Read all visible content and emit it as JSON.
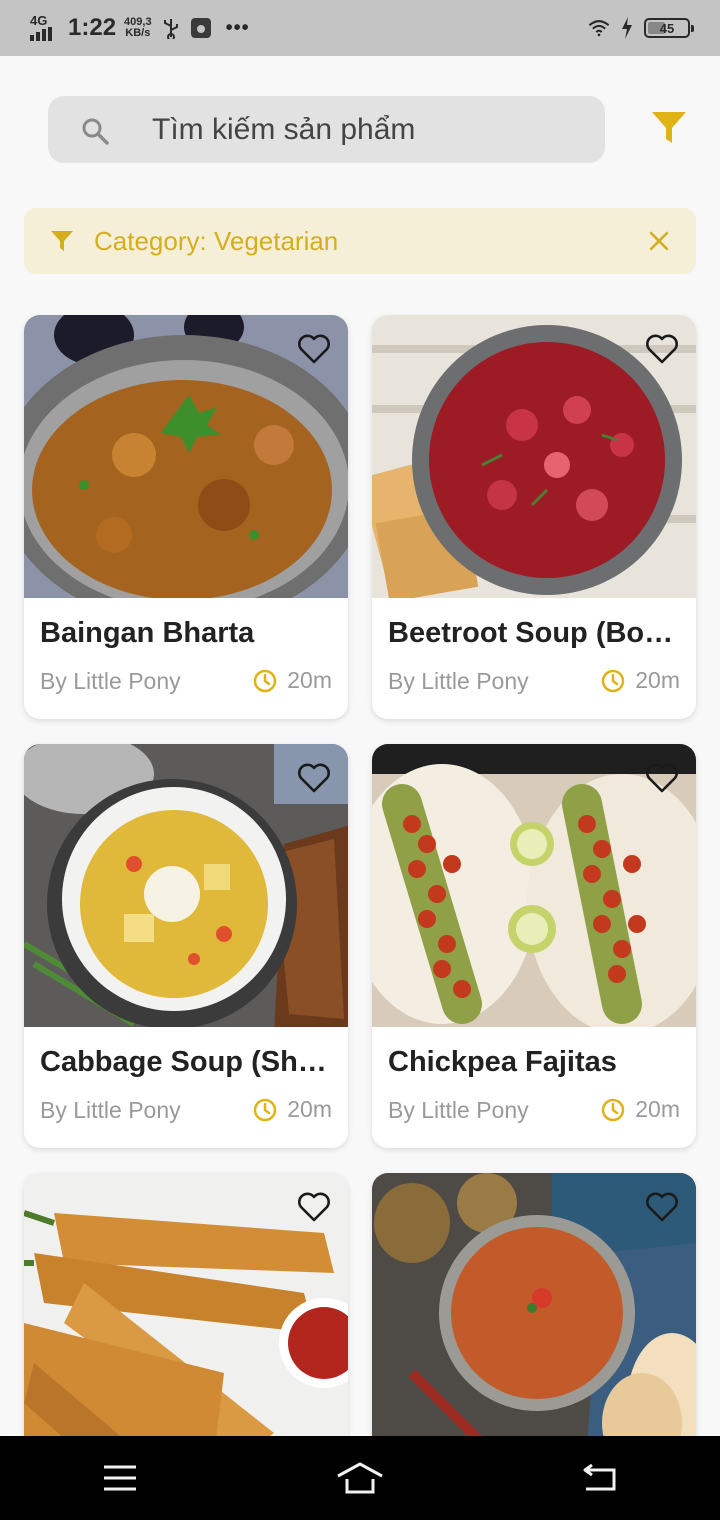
{
  "status_bar": {
    "network": "4G",
    "time": "1:22",
    "speed_value": "409,3",
    "speed_unit": "KB/s",
    "battery": "45",
    "battery_level": 0.45
  },
  "search": {
    "placeholder": "Tìm kiếm sản phẩm"
  },
  "filter_chip": {
    "label": "Category: Vegetarian"
  },
  "colors": {
    "accent": "#e0b315",
    "chip_bg": "#f6efd7",
    "search_bg": "#e2e2e2"
  },
  "recipes": [
    {
      "title": "Baingan Bharta",
      "author": "By Little Pony",
      "time": "20m"
    },
    {
      "title": "Beetroot Soup (Borscht)",
      "author": "By Little Pony",
      "time": "20m"
    },
    {
      "title": "Cabbage Soup (Shchi)",
      "author": "By Little Pony",
      "time": "20m"
    },
    {
      "title": "Chickpea Fajitas",
      "author": "By Little Pony",
      "time": "20m"
    },
    {
      "title": "",
      "author": "",
      "time": ""
    },
    {
      "title": "",
      "author": "",
      "time": ""
    }
  ],
  "nav": {
    "icons": [
      "menu-icon",
      "home-icon",
      "back-icon"
    ]
  }
}
